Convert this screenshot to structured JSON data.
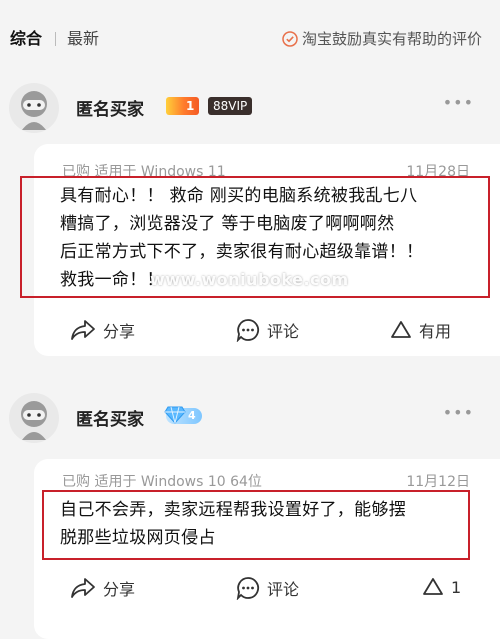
{
  "header": {
    "tab_active": "综合",
    "tab_latest": "最新",
    "notice": "淘宝鼓励真实有帮助的评价"
  },
  "reviews": [
    {
      "username": "匿名买家",
      "badge_level": "1",
      "badge_vip": "88VIP",
      "meta": "已购 适用于 Windows 11",
      "date": "11月28日",
      "content_lines": [
        "具有耐心！！ 救命 刚买的电脑系统被我乱七八",
        "糟搞了，浏览器没了 等于电脑废了啊啊啊然",
        "后正常方式下不了，卖家很有耐心超级靠谱！！",
        "救我一命！！"
      ],
      "share": "分享",
      "comment": "评论",
      "useful": "有用"
    },
    {
      "username": "匿名买家",
      "badge_diamond": "4",
      "meta": "已购 适用于 Windows 10 64位",
      "date": "11月12日",
      "content_lines": [
        "自己不会弄，卖家远程帮我设置好了，能够摆",
        "脱那些垃圾网页侵占"
      ],
      "share": "分享",
      "comment": "评论",
      "useful": "1"
    }
  ],
  "watermark": "www.woniuboke.com",
  "colors": {
    "highlight_box": "#c8202a",
    "notice_icon": "#e8704a"
  }
}
